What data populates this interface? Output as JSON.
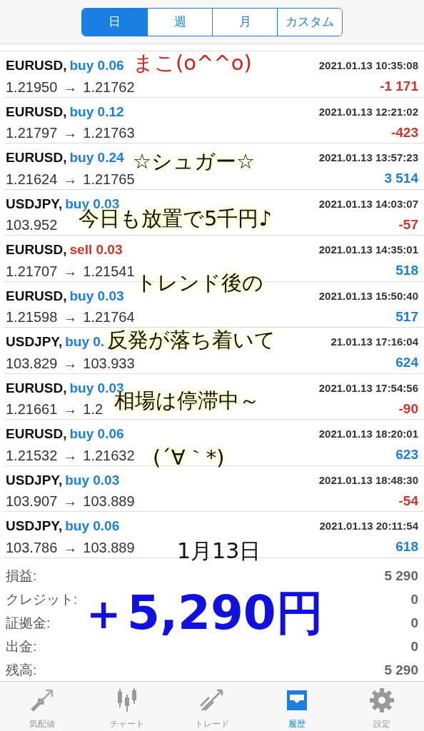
{
  "period_tabs": [
    {
      "label": "日",
      "selected": true
    },
    {
      "label": "週",
      "selected": false
    },
    {
      "label": "月",
      "selected": false
    },
    {
      "label": "カスタム",
      "selected": false
    }
  ],
  "deals": [
    {
      "symbol": "EURUSD,",
      "kind": "buy",
      "order": "buy 0.06",
      "time": "2021.01.13 10:35:08",
      "open": "1.21950",
      "arrow": "→",
      "close": "1.21762",
      "profit": "-1 171",
      "loss": true
    },
    {
      "symbol": "EURUSD,",
      "kind": "buy",
      "order": "buy 0.12",
      "time": "2021.01.13 12:21:02",
      "open": "1.21797",
      "arrow": "→",
      "close": "1.21763",
      "profit": "-423",
      "loss": true
    },
    {
      "symbol": "EURUSD,",
      "kind": "buy",
      "order": "buy 0.24",
      "time": "2021.01.13 13:57:23",
      "open": "1.21624",
      "arrow": "→",
      "close": "1.21765",
      "profit": "3 514",
      "loss": false
    },
    {
      "symbol": "USDJPY,",
      "kind": "buy",
      "order": "buy 0.03",
      "time": "2021.01.13 14:03:07",
      "open": "103.952",
      "profit": "-57",
      "loss": true
    },
    {
      "symbol": "EURUSD,",
      "kind": "sell",
      "order": "sell 0.03",
      "time": "2021.01.13 14:35:01",
      "open": "1.21707",
      "arrow": "→",
      "close": "1.21541",
      "profit": "518",
      "loss": false
    },
    {
      "symbol": "EURUSD,",
      "kind": "buy",
      "order": "buy 0.03",
      "time": "2021.01.13 15:50:40",
      "open": "1.21598",
      "arrow": "→",
      "close": "1.21764",
      "profit": "517",
      "loss": false
    },
    {
      "symbol": "USDJPY,",
      "kind": "buy",
      "order": "buy 0.",
      "time": "21.01.13 17:16:04",
      "open": "103.829",
      "arrow": "→",
      "close": "103.933",
      "profit": "624",
      "loss": false
    },
    {
      "symbol": "EURUSD,",
      "kind": "buy",
      "order": "buy 0.03",
      "time": "2021.01.13 17:54:56",
      "open": "1.21661",
      "arrow": "→",
      "close": "1.2",
      "profit": "-90",
      "loss": true
    },
    {
      "symbol": "EURUSD,",
      "kind": "buy",
      "order": "buy 0.06",
      "time": "2021.01.13 18:20:01",
      "open": "1.21532",
      "arrow": "→",
      "close": "1.21632",
      "profit": "623",
      "loss": false
    },
    {
      "symbol": "USDJPY,",
      "kind": "buy",
      "order": "buy 0.03",
      "time": "2021.01.13 18:48:30",
      "open": "103.907",
      "arrow": "→",
      "close": "103.889",
      "profit": "-54",
      "loss": true
    },
    {
      "symbol": "USDJPY,",
      "kind": "buy",
      "order": "buy 0.06",
      "time": "2021.01.13 20:11:54",
      "open": "103.786",
      "arrow": "→",
      "close": "103.889",
      "profit": "618",
      "loss": false
    }
  ],
  "summary": [
    {
      "label": "損益:",
      "value": "5 290"
    },
    {
      "label": "クレジット:",
      "value": "0"
    },
    {
      "label": "証拠金:",
      "value": "0"
    },
    {
      "label": "出金:",
      "value": "0"
    },
    {
      "label": "残高:",
      "value": "5 290"
    }
  ],
  "handwritten_notes": [
    {
      "text": "まこ(o^^o)",
      "kind": "name"
    },
    {
      "text": "☆シュガー☆",
      "kind": "glow"
    },
    {
      "text": "今日も放置で5千円♪",
      "kind": "glow"
    },
    {
      "text": "トレンド後の",
      "kind": "glow"
    },
    {
      "text": "反発が落ち着いて",
      "kind": "glow"
    },
    {
      "text": "相場は停滞中～",
      "kind": "glow"
    },
    {
      "text": "(´∀｀*)",
      "kind": "glow"
    },
    {
      "text": "1月13日",
      "kind": "date"
    },
    {
      "text": "＋5,290円",
      "kind": "total"
    }
  ],
  "tab_bar": [
    {
      "label": "気配値",
      "selected": false
    },
    {
      "label": "チャート",
      "selected": false
    },
    {
      "label": "トレード",
      "selected": false
    },
    {
      "label": "履歴",
      "selected": true
    },
    {
      "label": "設定",
      "selected": false
    }
  ]
}
